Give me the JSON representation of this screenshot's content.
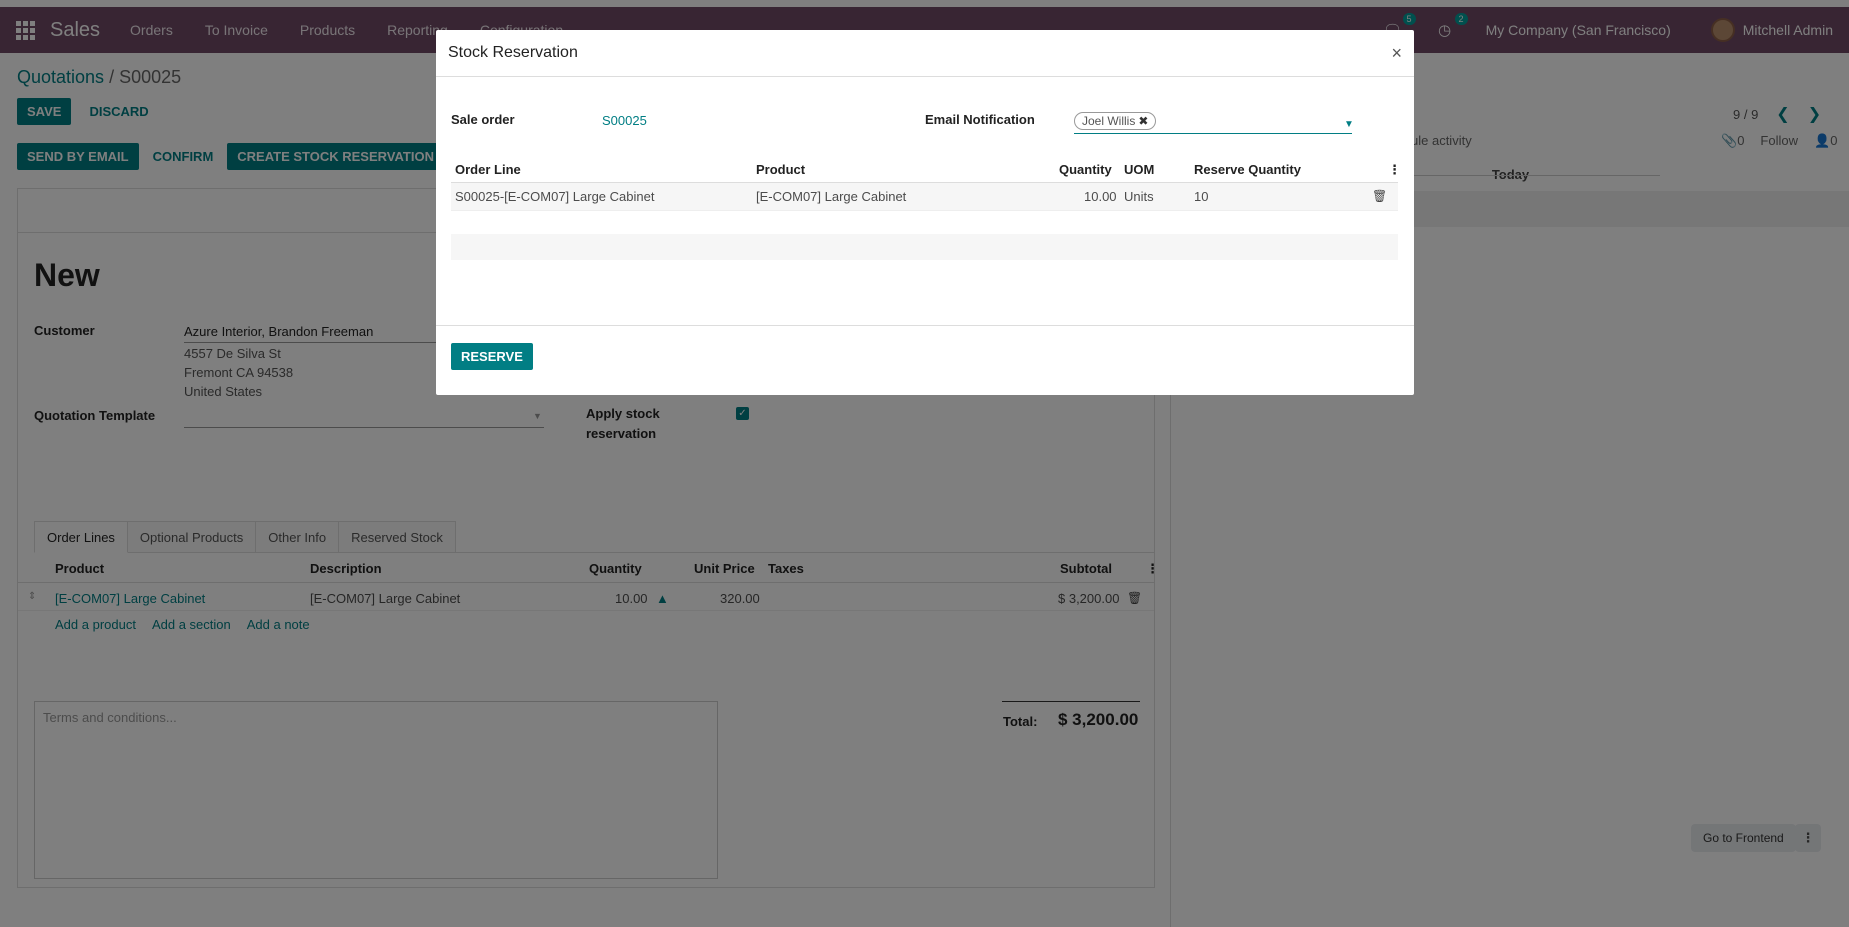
{
  "nav": {
    "brand": "Sales",
    "menu": [
      "Orders",
      "To Invoice",
      "Products",
      "Reporting",
      "Configuration"
    ],
    "messages_badge": "5",
    "activities_badge": "2",
    "company": "My Company (San Francisco)",
    "user": "Mitchell Admin"
  },
  "breadcrumb": {
    "parent": "Quotations",
    "separator": "/",
    "current": "S00025"
  },
  "buttons": {
    "save": "SAVE",
    "discard": "DISCARD",
    "send_email": "SEND BY EMAIL",
    "confirm": "CONFIRM",
    "create_reservation": "CREATE STOCK RESERVATION",
    "go_frontend": "Go to Frontend"
  },
  "pager": {
    "text": "9 / 9"
  },
  "form": {
    "title": "New",
    "customer_label": "Customer",
    "customer_name": "Azure Interior, Brandon Freeman",
    "address_line1": "4557 De Silva St",
    "address_line2": "Fremont CA 94538",
    "address_line3": "United States",
    "template_label": "Quotation Template",
    "apply_label_1": "Apply stock",
    "apply_label_2": "reservation"
  },
  "tabs": [
    "Order Lines",
    "Optional Products",
    "Other Info",
    "Reserved Stock"
  ],
  "order_lines": {
    "headers": {
      "product": "Product",
      "description": "Description",
      "quantity": "Quantity",
      "unit_price": "Unit Price",
      "taxes": "Taxes",
      "subtotal": "Subtotal"
    },
    "row": {
      "product": "[E-COM07] Large Cabinet",
      "description": "[E-COM07] Large Cabinet",
      "quantity": "10.00",
      "unit_price": "320.00",
      "subtotal": "$ 3,200.00"
    },
    "add_product": "Add a product",
    "add_section": "Add a section",
    "add_note": "Add a note"
  },
  "terms_placeholder": "Terms and conditions...",
  "total": {
    "label": "Total:",
    "value": "$ 3,200.00"
  },
  "chatter": {
    "activity": "ule activity",
    "attachments": "0",
    "follow": "Follow",
    "followers": "0",
    "today": "Today"
  },
  "modal": {
    "title": "Stock Reservation",
    "close": "×",
    "sale_order_label": "Sale order",
    "sale_order_value": "S00025",
    "email_label": "Email Notification",
    "email_tag": "Joel Willis",
    "headers": {
      "order_line": "Order Line",
      "product": "Product",
      "quantity": "Quantity",
      "uom": "UOM",
      "reserve_qty": "Reserve Quantity"
    },
    "row": {
      "order_line": "S00025-[E-COM07] Large Cabinet",
      "product": "[E-COM07] Large Cabinet",
      "quantity": "10.00",
      "uom": "Units",
      "reserve_qty": "10"
    },
    "reserve_button": "RESERVE"
  }
}
